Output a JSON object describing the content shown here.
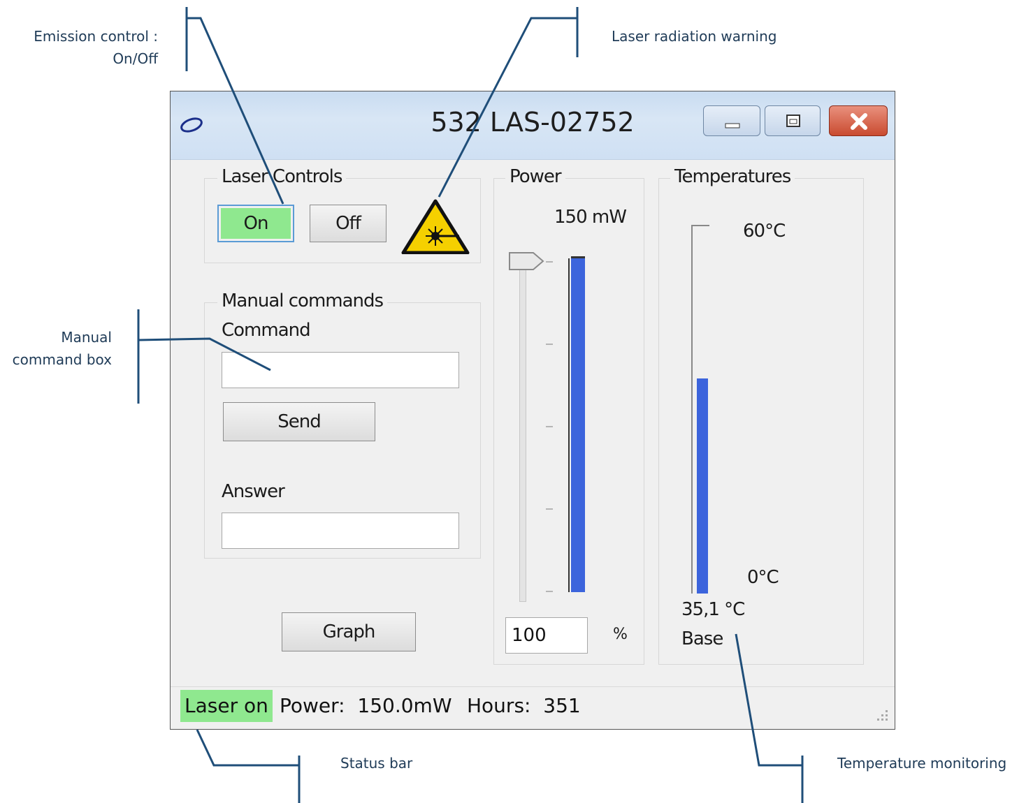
{
  "callouts": {
    "emission_line1": "Emission control :",
    "emission_line2": "On/Off",
    "laser_warning": "Laser radiation warning",
    "manual_line1": "Manual",
    "manual_line2": "command box",
    "status_bar": "Status bar",
    "temperature": "Temperature monitoring"
  },
  "window": {
    "title": "532 LAS-02752",
    "controls": [
      "minimize-icon",
      "maximize-icon",
      "close-icon"
    ]
  },
  "laser_controls": {
    "group_label": "Laser Controls",
    "on_label": "On",
    "off_label": "Off",
    "on_color": "#8fe88f",
    "warning_icon": "laser-warning-icon"
  },
  "manual_commands": {
    "group_label": "Manual commands",
    "command_label": "Command",
    "command_value": "",
    "send_label": "Send",
    "answer_label": "Answer",
    "answer_value": ""
  },
  "graph_label": "Graph",
  "power": {
    "group_label": "Power",
    "readout": "150 mW",
    "percent_value": "100",
    "percent_unit": "%",
    "level_fraction": 1.0,
    "bar_color": "#3c64dc"
  },
  "temperatures": {
    "group_label": "Temperatures",
    "max_label": "60°C",
    "min_label": "0°C",
    "reading": "35,1 °C",
    "sensor_label": "Base",
    "level_fraction": 0.585,
    "bar_color": "#3c64dc"
  },
  "status": {
    "state_label": "Laser on",
    "state_color": "#8fe88f",
    "power_text": "Power:  150.0mW",
    "hours_text": "Hours:  351"
  }
}
